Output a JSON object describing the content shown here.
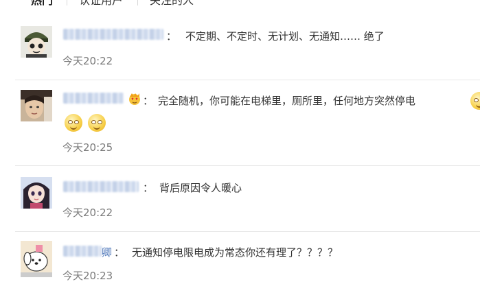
{
  "tabs": [
    {
      "label": "热门",
      "active": true
    },
    {
      "label": "认证用户",
      "active": false
    },
    {
      "label": "关注的人",
      "active": false
    }
  ],
  "comments": [
    {
      "name_tail": "",
      "colon": "：",
      "text": "不定期、不定时、无计划、无通知…… 绝了",
      "time": "今天20:22",
      "avatar": "cartoon-boy-avatar"
    },
    {
      "name_tail": "",
      "colon": "：",
      "text": "完全随机，你可能在电梯里，厕所里，任何地方突然停电",
      "time": "今天20:25",
      "avatar": "photo-man-avatar",
      "badge": "heart-eyes-badge-icon",
      "emojis": [
        "smile-emoji-icon",
        "smile-emoji-icon",
        "smile-emoji-icon"
      ]
    },
    {
      "name_tail": "",
      "colon": "：",
      "text": "背后原因令人暖心",
      "time": "今天20:22",
      "avatar": "anime-girl-avatar"
    },
    {
      "name_tail": "卿",
      "colon": "：",
      "text": "无通知停电限电成为常态你还有理了？？？？",
      "time": "今天20:23",
      "avatar": "pochacco-avatar"
    }
  ],
  "colors": {
    "name_link": "#4a74b8",
    "time": "#7a7a7a",
    "divider": "#e6e6e6"
  }
}
